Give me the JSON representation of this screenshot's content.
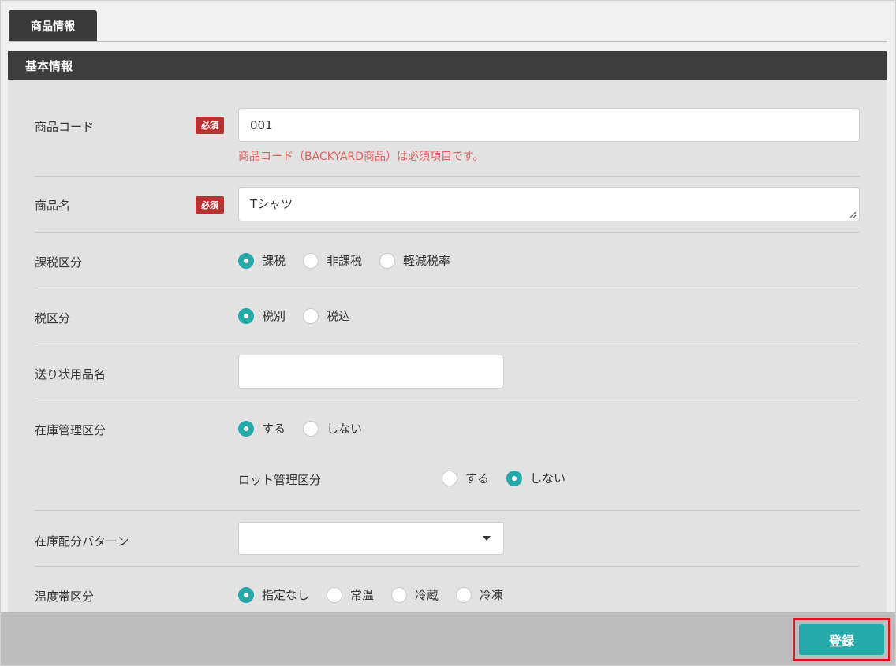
{
  "tab": {
    "label": "商品情報"
  },
  "section": {
    "title": "基本情報"
  },
  "required_badge": "必須",
  "form": {
    "product_code": {
      "label": "商品コード",
      "value": "001",
      "error": "商品コード（BACKYARD商品）は必須項目です。"
    },
    "product_name": {
      "label": "商品名",
      "value": "Tシャツ"
    },
    "tax_category": {
      "label": "課税区分",
      "options": [
        "課税",
        "非課税",
        "軽減税率"
      ],
      "selected": "課税"
    },
    "tax_type": {
      "label": "税区分",
      "options": [
        "税別",
        "税込"
      ],
      "selected": "税別"
    },
    "shipping_name": {
      "label": "送り状用品名",
      "value": ""
    },
    "stock_management": {
      "label": "在庫管理区分",
      "options": [
        "する",
        "しない"
      ],
      "selected": "する"
    },
    "lot_management": {
      "label": "ロット管理区分",
      "options": [
        "する",
        "しない"
      ],
      "selected": "しない"
    },
    "stock_allocation": {
      "label": "在庫配分パターン",
      "value": ""
    },
    "temperature_zone": {
      "label": "温度帯区分",
      "options": [
        "指定なし",
        "常温",
        "冷蔵",
        "冷凍"
      ],
      "selected": "指定なし"
    }
  },
  "footer": {
    "submit_label": "登録"
  },
  "colors": {
    "accent": "#25a9ab",
    "required": "#b83232",
    "error": "#e06060",
    "highlight_border": "#e0161c"
  }
}
